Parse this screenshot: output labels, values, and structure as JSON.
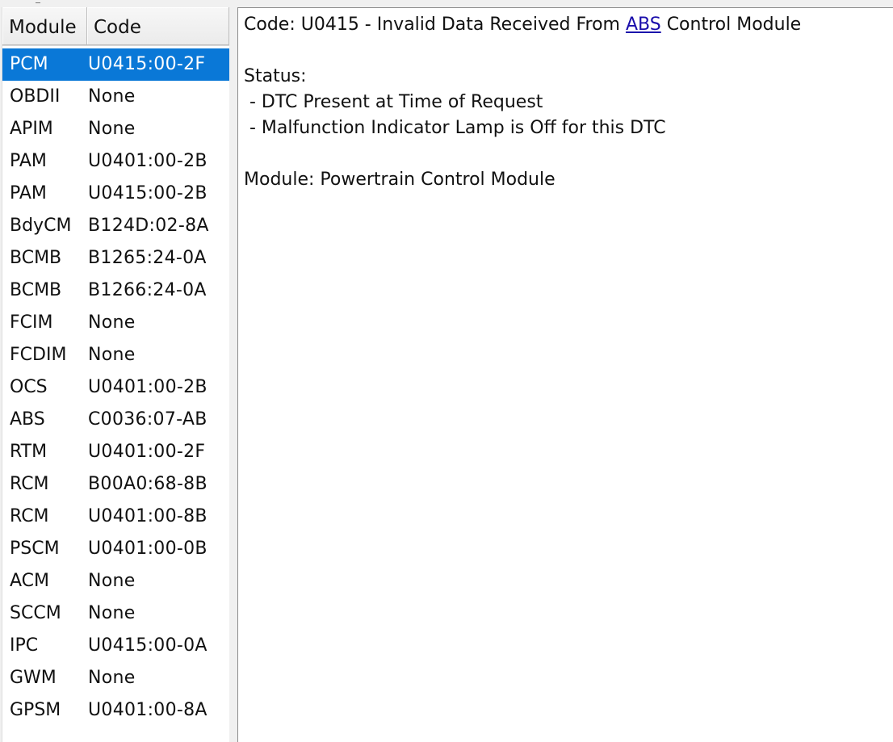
{
  "list": {
    "headers": {
      "module": "Module",
      "code": "Code"
    },
    "selected_index": 0,
    "rows": [
      {
        "module": "PCM",
        "code": "U0415:00-2F"
      },
      {
        "module": "OBDII",
        "code": "None"
      },
      {
        "module": "APIM",
        "code": "None"
      },
      {
        "module": "PAM",
        "code": "U0401:00-2B"
      },
      {
        "module": "PAM",
        "code": "U0415:00-2B"
      },
      {
        "module": "BdyCM",
        "code": "B124D:02-8A"
      },
      {
        "module": "BCMB",
        "code": "B1265:24-0A"
      },
      {
        "module": "BCMB",
        "code": "B1266:24-0A"
      },
      {
        "module": "FCIM",
        "code": "None"
      },
      {
        "module": "FCDIM",
        "code": "None"
      },
      {
        "module": "OCS",
        "code": "U0401:00-2B"
      },
      {
        "module": "ABS",
        "code": "C0036:07-AB"
      },
      {
        "module": "RTM",
        "code": "U0401:00-2F"
      },
      {
        "module": "RCM",
        "code": "B00A0:68-8B"
      },
      {
        "module": "RCM",
        "code": "U0401:00-8B"
      },
      {
        "module": "PSCM",
        "code": "U0401:00-0B"
      },
      {
        "module": "ACM",
        "code": "None"
      },
      {
        "module": "SCCM",
        "code": "None"
      },
      {
        "module": "IPC",
        "code": "U0415:00-0A"
      },
      {
        "module": "GWM",
        "code": "None"
      },
      {
        "module": "GPSM",
        "code": "U0401:00-8A"
      }
    ]
  },
  "detail": {
    "code_prefix": "Code: U0415 - Invalid Data Received From ",
    "code_link": "ABS",
    "code_suffix": " Control Module",
    "status_label": "Status:",
    "status_items": [
      " - DTC Present at Time of Request",
      " - Malfunction Indicator Lamp is Off for this DTC"
    ],
    "module_line": "Module: Powertrain Control Module"
  },
  "colors": {
    "selection": "#0a78d7",
    "link": "#1a0dab"
  }
}
